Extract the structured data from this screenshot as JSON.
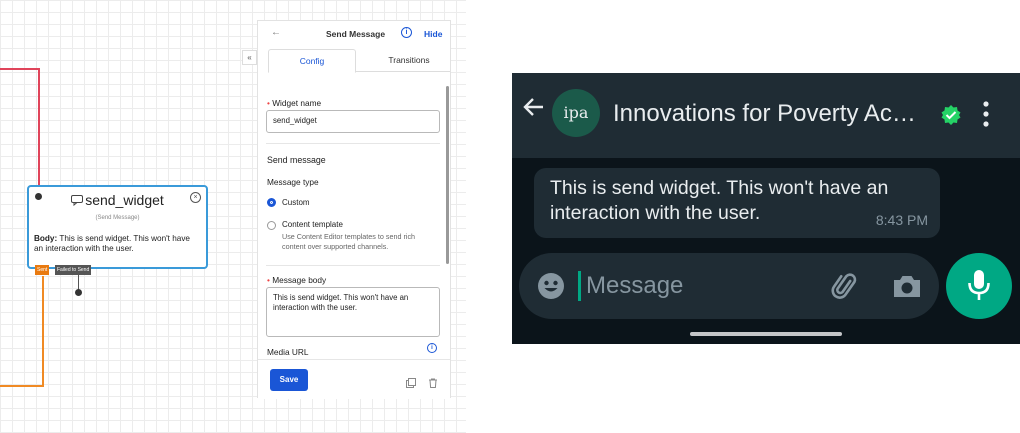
{
  "canvas": {
    "node": {
      "title": "send_widget",
      "subtitle": "(Send Message)",
      "body_label": "Body:",
      "body_text": " This is send widget. This won't have an interaction with the user.",
      "tag_sent": "Sent",
      "tag_failed": "Failed to Send"
    },
    "colors": {
      "wire_red": "#e0445a",
      "wire_orange": "#f08a24",
      "node_border": "#3a9ad9",
      "tag_sent": "#e97a10",
      "tag_failed": "#555555"
    }
  },
  "panel": {
    "back_icon": "arrow-left-icon",
    "title": "Send Message",
    "info_icon": "info-icon",
    "hide_label": "Hide",
    "collapse_icon": "double-chevron-left-icon",
    "tabs": [
      {
        "label": "Config"
      },
      {
        "label": "Transitions"
      }
    ],
    "widget_name_label": "Widget name",
    "widget_name_value": "send_widget",
    "section_title": "Send message",
    "message_type_label": "Message type",
    "option_custom": "Custom",
    "option_template": "Content template",
    "option_template_help": "Use Content Editor templates to send rich content over supported channels.",
    "message_body_label": "Message body",
    "message_body_value": "This is send widget. This won't have an interaction with the user.",
    "media_url_label": "Media URL",
    "save_label": "Save",
    "copy_icon": "copy-icon",
    "trash_icon": "trash-icon",
    "accent": "#1a56d6"
  },
  "phone": {
    "back_icon": "arrow-left-icon",
    "avatar_text": "ipa",
    "contact_name": "Innovations for Poverty Ac…",
    "verified_icon": "verified-badge-icon",
    "menu_icon": "more-vertical-icon",
    "message_text": "This is send widget. This won't have an interaction with the user.",
    "message_time": "8:43 PM",
    "emoji_icon": "emoji-icon",
    "input_placeholder": "Message",
    "attach_icon": "paperclip-icon",
    "camera_icon": "camera-icon",
    "mic_icon": "microphone-icon",
    "colors": {
      "bg": "#0b141a",
      "bar": "#1f2c34",
      "green": "#00a884",
      "verified": "#25d366"
    }
  }
}
